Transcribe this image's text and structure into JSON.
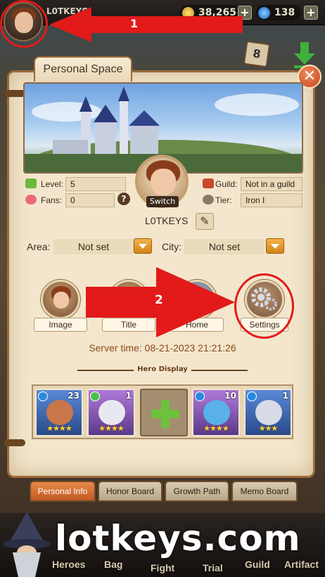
{
  "topbar": {
    "player_name": "L0TKEYS",
    "gold": "38,265",
    "gems": "138",
    "plus": "+"
  },
  "annotations": {
    "marker1": "1",
    "marker2": "2"
  },
  "calendar_day": "8",
  "panel": {
    "title": "Personal Space",
    "close": "✕",
    "switch_label": "Switch",
    "stats": {
      "level_label": "Level:",
      "level_value": "5",
      "fans_label": "Fans:",
      "fans_value": "0",
      "fans_help": "?",
      "guild_label": "Guild:",
      "guild_value": "Not in a guild",
      "tier_label": "Tier:",
      "tier_value": "Iron I"
    },
    "username": "L0TKEYS",
    "area_label": "Area:",
    "area_value": "Not set",
    "city_label": "City:",
    "city_value": "Not set",
    "buttons": [
      {
        "label": "Image"
      },
      {
        "label": "Title"
      },
      {
        "label": "Home"
      },
      {
        "label": "Settings"
      }
    ],
    "server_time": "Server time: 08-21-2023 21:21:26",
    "hero_display_title": "Hero Display",
    "heroes": [
      {
        "level": "23",
        "element": "water",
        "stars": "★★★★"
      },
      {
        "level": "1",
        "element": "wind",
        "stars": "★★★★"
      },
      {
        "level": "10",
        "element": "water",
        "stars": "★★★★"
      },
      {
        "level": "1",
        "element": "water",
        "stars": "★★★"
      }
    ]
  },
  "tabs": [
    "Personal Info",
    "Honor Board",
    "Growth Path",
    "Memo Board"
  ],
  "bottom_nav": [
    "Heroes",
    "Bag",
    "Fight",
    "Trial",
    "Guild",
    "Artifact"
  ],
  "watermark": "lotkeys.com",
  "colors": {
    "accent_red": "#e21a1a",
    "parchment": "#f3e6cc",
    "active_tab": "#c05a24",
    "dropdown": "#f2b24a"
  }
}
